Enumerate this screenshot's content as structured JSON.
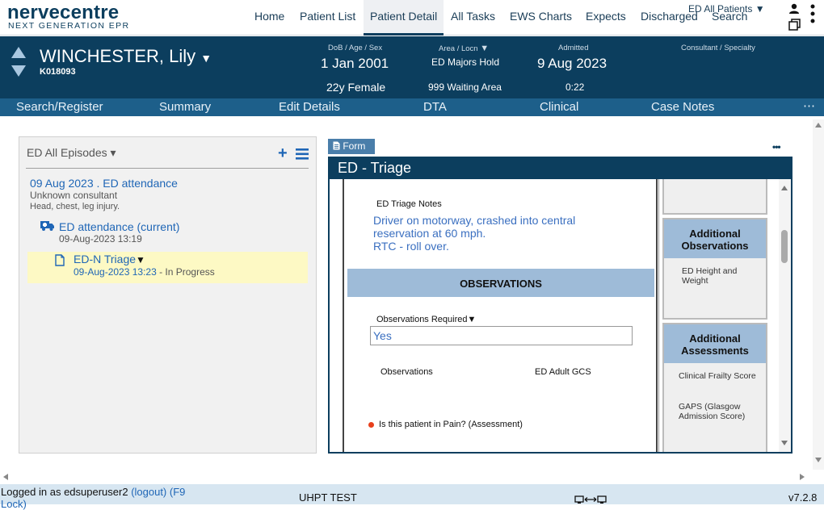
{
  "logo": {
    "main": "nervecentre",
    "sub": "NEXT GENERATION EPR"
  },
  "nav": {
    "items": [
      "Home",
      "Patient List",
      "Patient Detail",
      "All Tasks",
      "EWS Charts",
      "Expects",
      "Discharged"
    ],
    "search": "Search",
    "ed_all_patients": "ED All Patients ▼"
  },
  "patient": {
    "name": "WINCHESTER, Lily",
    "name_caret": "▼",
    "id": "K018093",
    "dob_label": "DoB / Age / Sex",
    "dob": "1 Jan 2001",
    "age_sex": "22y Female",
    "area_label": "Area / Locn",
    "area_caret": "▼",
    "area": "ED Majors Hold",
    "locn": "999 Waiting Area",
    "admitted_label": "Admitted",
    "admitted": "9 Aug 2023",
    "admitted_time": "0:22",
    "consultant_label": "Consultant / Specialty"
  },
  "tabs": [
    "Search/Register",
    "Summary",
    "Edit Details",
    "DTA",
    "Clinical",
    "Case Notes"
  ],
  "tabs_more": "⋯",
  "episodes": {
    "header": "ED All Episodes ▾",
    "episode_title": "09 Aug 2023 . ED attendance",
    "episode_consultant": "Unknown consultant",
    "episode_reason": "Head, chest, leg injury.",
    "attendance_label": "ED attendance (current)",
    "attendance_time": "09-Aug-2023 13:19",
    "triage_label": "ED-N Triage",
    "triage_caret": "▼",
    "triage_time": "09-Aug-2023 13:23",
    "triage_status": " - In Progress"
  },
  "form": {
    "tab_label": "Form",
    "title": "ED - Triage",
    "notes_label": "ED Triage Notes",
    "notes_text": [
      "Driver on motorway, crashed into central",
      "reservation at 60 mph.",
      "RTC - roll over."
    ],
    "observations_header": "OBSERVATIONS",
    "obs_required_label": "Observations Required",
    "obs_required_caret": "▼",
    "obs_required_value": "Yes",
    "observations_link": "Observations",
    "gcs_link": "ED Adult GCS",
    "pain_question": "Is this patient in Pain? (Assessment)",
    "more": "•••"
  },
  "side_cards": [
    {
      "header": "Additional Observations",
      "items": [
        "ED Height and Weight"
      ]
    },
    {
      "header": "Additional Assessments",
      "items": [
        "Clinical Frailty Score",
        "GAPS (Glasgow Admission Score)"
      ]
    }
  ],
  "status": {
    "logged_in": "Logged in as edsuperuser2",
    "logout": "(logout)",
    "lock": "(F9 Lock)",
    "env": "UHPT TEST",
    "version": "v7.2.8"
  },
  "colors": {
    "brand_dark": "#0c3e5e",
    "tab_bar": "#1d5f8a",
    "link": "#1f66b6",
    "highlight": "#fdf9c4",
    "pain_dot": "#e8401c"
  }
}
